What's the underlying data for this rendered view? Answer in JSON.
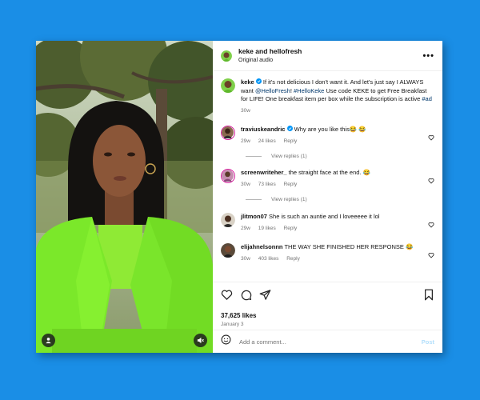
{
  "header": {
    "title": "keke and hellofresh",
    "subtitle": "Original audio",
    "more_icon": "more-horizontal-icon"
  },
  "caption": {
    "username": "keke",
    "verified": true,
    "text1": "If it's not delicious I don't want it. And let's just say I ALWAYS want ",
    "mention": "@HelloFresh",
    "text2": "! ",
    "hashtag1": "#HelloKeke",
    "text3": " Use code KEKE to get Free Breakfast for LIFE! One breakfast item per box while the subscription is active ",
    "hashtag2": "#ad",
    "time": "30w"
  },
  "comments": [
    {
      "username": "traviuskeandric",
      "verified": true,
      "text": "Why are you like this😂 😂",
      "time": "29w",
      "likes": "24 likes",
      "reply": "Reply",
      "view_replies": "View replies (1)"
    },
    {
      "username": "screenwriteher_",
      "verified": false,
      "text": "the straight face at the end. 😂",
      "time": "30w",
      "likes": "73 likes",
      "reply": "Reply",
      "view_replies": "View replies (1)"
    },
    {
      "username": "jlitmon07",
      "verified": false,
      "text": "She is such an auntie and I loveeeee it lol",
      "time": "29w",
      "likes": "19 likes",
      "reply": "Reply"
    },
    {
      "username": "elijahnelsonnn",
      "verified": false,
      "text": "THE WAY SHE FINISHED HER RESPONSE 😂",
      "time": "30w",
      "likes": "403 likes",
      "reply": "Reply"
    }
  ],
  "actions": {
    "likes": "37,625 likes",
    "date": "January 3"
  },
  "add_comment": {
    "placeholder": "Add a comment...",
    "post_label": "Post"
  },
  "colors": {
    "background": "#1a8ee6",
    "link": "#00376b",
    "verified": "#0095f6",
    "post_disabled": "#b2dffc",
    "blazer": "#7be82a"
  }
}
